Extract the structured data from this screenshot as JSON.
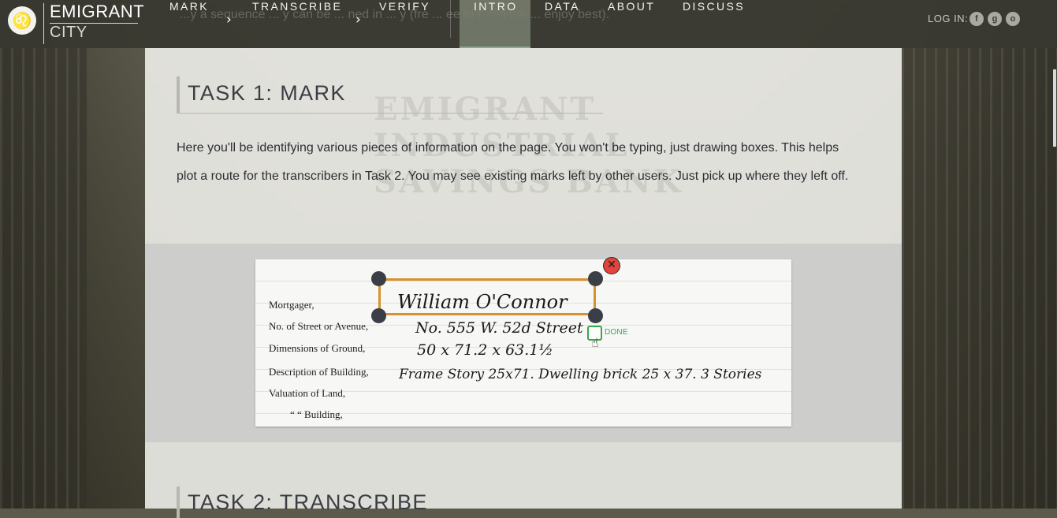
{
  "logo": {
    "line1": "EMIGRANT",
    "line2": "CITY",
    "icon": "lion-icon"
  },
  "nav": {
    "items": [
      "MARK",
      "TRANSCRIBE",
      "VERIFY",
      "INTRO",
      "DATA",
      "ABOUT",
      "DISCUSS"
    ],
    "separator": "›",
    "active": "INTRO",
    "ghost_text": "...y a sequence ... y can be ... ned in ... y (fre ... ee to f ... n the ... enjoy best).",
    "login_label": "LOG IN:",
    "social": [
      "f",
      "g",
      "o"
    ]
  },
  "panel": {
    "watermark": "EMIGRANT\nINDUSTRIAL\nSAVINGS BANK",
    "task1_title": "TASK 1: MARK",
    "task1_body": "Here you'll be identifying various pieces of information on the page. You won't be typing, just drawing boxes. This helps plot a route for the transcribers in Task 2. You may see existing marks left by other users. Just pick up where they left off.",
    "task2_title": "TASK 2: TRANSCRIBE"
  },
  "ledger": {
    "labels": [
      "Mortgager,",
      "No. of Street or Avenue,",
      "Dimensions of Ground,",
      "Description of Building,",
      "Valuation of Land,",
      "“      “  Building,"
    ],
    "handwriting": [
      "William O'Connor",
      "No. 555  W. 52d Street",
      "50 x 71.2 x 63.1½",
      "Frame Story 25x71. Dwelling brick 25 x 37. 3 Stories"
    ],
    "marker_done_label": "DONE",
    "close_symbol": "✕"
  }
}
